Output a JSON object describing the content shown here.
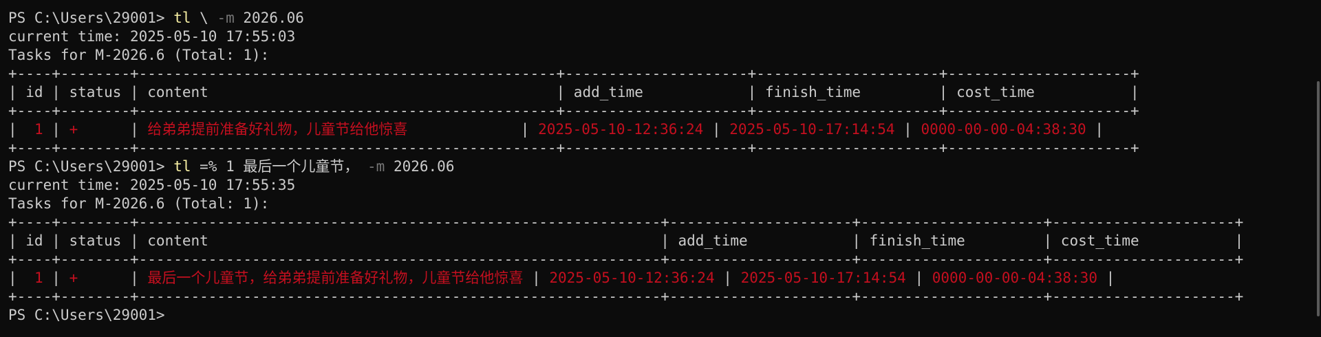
{
  "prompt": "PS C:\\Users\\29001> ",
  "commands": [
    {
      "exe": "tl",
      "args": [
        {
          "text": " \\ ",
          "kind": "plain"
        },
        {
          "text": "-m",
          "kind": "param"
        },
        {
          "text": " 2026.06",
          "kind": "plain"
        }
      ],
      "current_time": "current time: 2025-05-10 17:55:03",
      "tasks_header": "Tasks for M-2026.6 (Total: 1):",
      "table": {
        "border": "+----+--------+------------------------------------------------+---------------------+---------------------+---------------------+",
        "header": "| id | status | content                                        | add_time            | finish_time         | cost_time           |",
        "rows": [
          {
            "id": "1",
            "status": "+",
            "content": "给弟弟提前准备好礼物，儿童节给他惊喜",
            "content_pad": "            ",
            "add_time": "2025-05-10-12:36:24",
            "finish_time": "2025-05-10-17:14:54",
            "cost_time": "0000-00-00-04:38:30"
          }
        ]
      }
    },
    {
      "exe": "tl",
      "args": [
        {
          "text": " =% 1 最后一个儿童节， ",
          "kind": "plain"
        },
        {
          "text": "-m",
          "kind": "param"
        },
        {
          "text": " 2026.06",
          "kind": "plain"
        }
      ],
      "current_time": "current time: 2025-05-10 17:55:35",
      "tasks_header": "Tasks for M-2026.6 (Total: 1):",
      "table": {
        "border": "+----+--------+------------------------------------------------------------+---------------------+---------------------+---------------------+",
        "header": "| id | status | content                                                    | add_time            | finish_time         | cost_time           |",
        "rows": [
          {
            "id": "1",
            "status": "+",
            "content": "最后一个儿童节，给弟弟提前准备好礼物，儿童节给他惊喜",
            "content_pad": "",
            "add_time": "2025-05-10-12:36:24",
            "finish_time": "2025-05-10-17:14:54",
            "cost_time": "0000-00-00-04:38:30"
          }
        ]
      }
    }
  ],
  "colors": {
    "background": "#0c0c0c",
    "foreground": "#cccccc",
    "command": "#f9f1a5",
    "parameter": "#767676",
    "task_row": "#c50f1f"
  }
}
